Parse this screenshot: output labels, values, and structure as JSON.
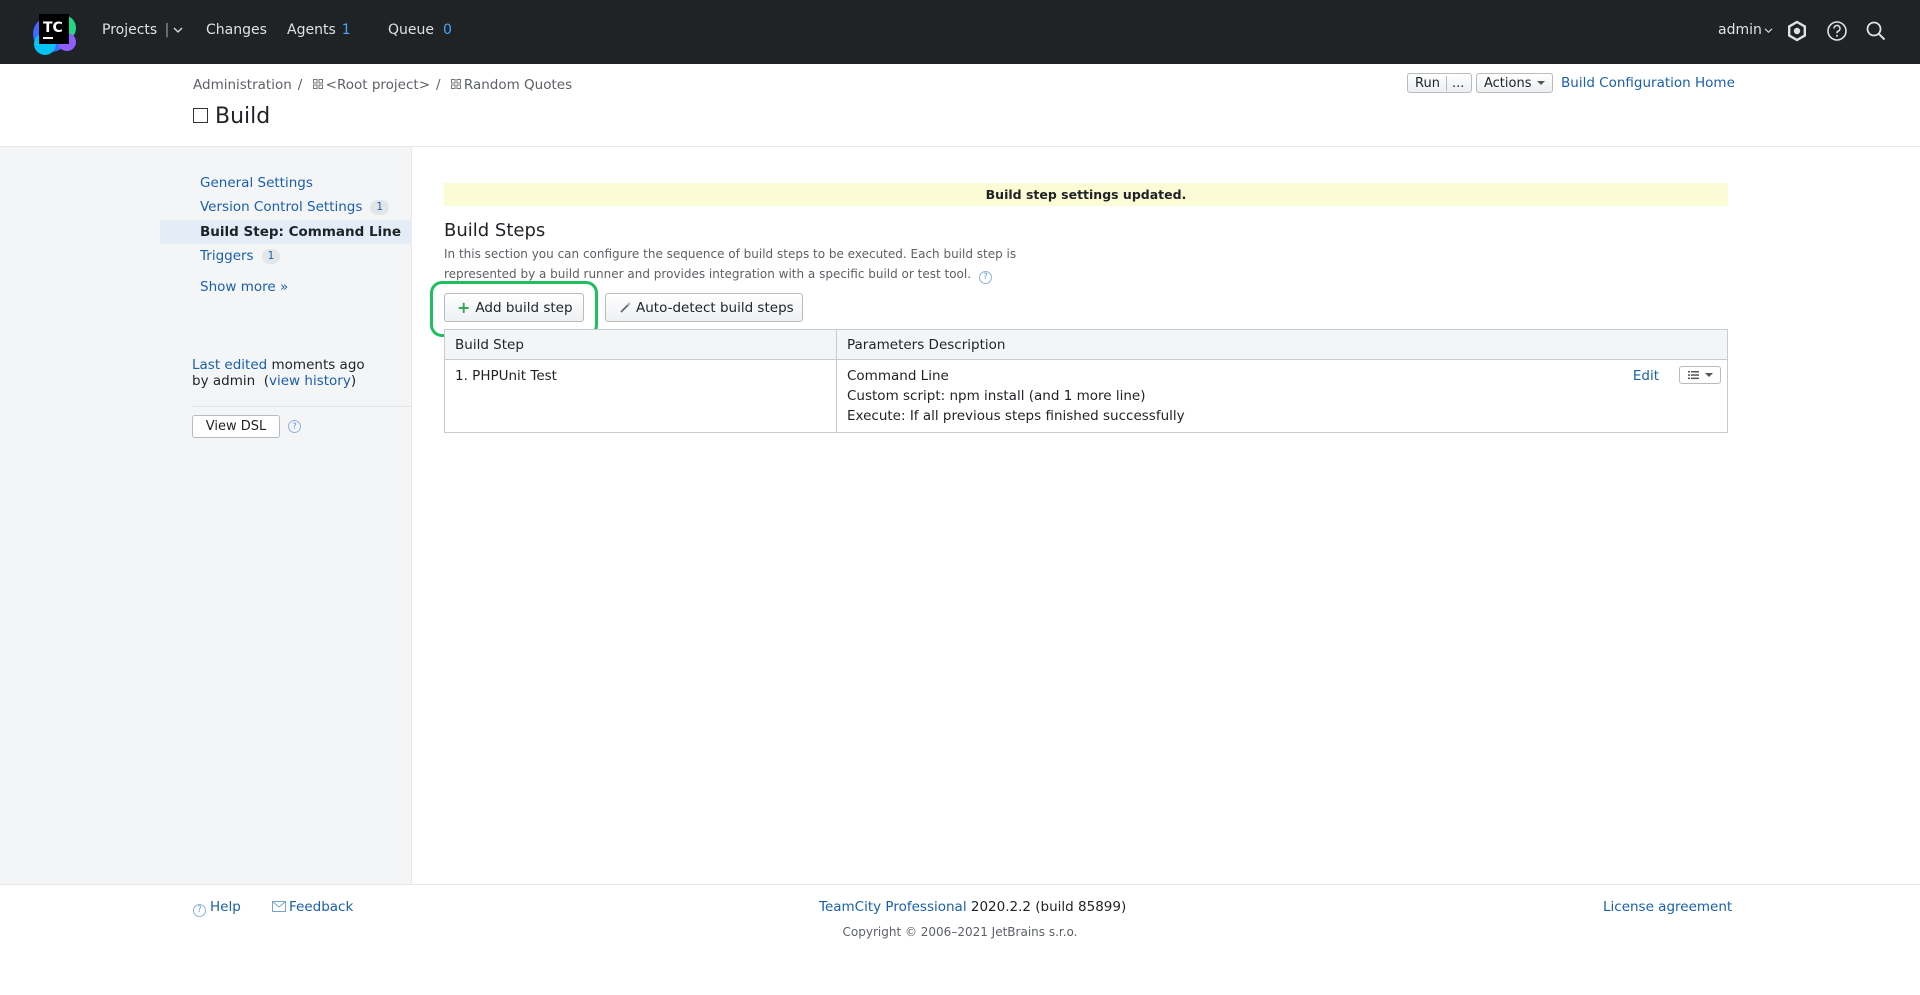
{
  "nav": {
    "logo_text": "TC",
    "projects": "Projects",
    "changes": "Changes",
    "agents": "Agents",
    "agents_count": "1",
    "queue": "Queue",
    "queue_count": "0",
    "user": "admin"
  },
  "header": {
    "breadcrumb": [
      "Administration",
      "<Root project>",
      "Random Quotes"
    ],
    "title": "Build",
    "run_label": "Run",
    "run_more_label": "...",
    "actions_label": "Actions",
    "home_link": "Build Configuration Home"
  },
  "sidebar": {
    "items": [
      {
        "label": "General Settings"
      },
      {
        "label": "Version Control Settings",
        "badge": "1"
      },
      {
        "label": "Build Step: Command Line"
      },
      {
        "label": "Triggers",
        "badge": "1"
      },
      {
        "label": "Show more »"
      }
    ],
    "last_edited": "Last edited",
    "last_edited_when": "moments ago",
    "by_admin": "by admin",
    "view_history": "view history",
    "view_dsl": "View DSL"
  },
  "main": {
    "notice": "Build step settings updated.",
    "section_title": "Build Steps",
    "section_desc": "In this section you can configure the sequence of build steps to be executed. Each build step is represented by a build runner and provides integration with a specific build or test tool.",
    "add_step": "Add build step",
    "auto_detect": "Auto-detect build steps",
    "table": {
      "headers": [
        "Build Step",
        "Parameters Description"
      ],
      "rows": [
        {
          "step": "1. PHPUnit Test",
          "params": [
            "Command Line",
            "Custom script: npm install (and 1 more line)",
            "Execute: If all previous steps finished successfully"
          ],
          "edit": "Edit"
        }
      ]
    }
  },
  "footer": {
    "help": "Help",
    "feedback": "Feedback",
    "product": "TeamCity Professional",
    "version": "2020.2.2 (build 85899)",
    "license": "License agreement",
    "copyright": "Copyright © 2006–2021 JetBrains s.r.o."
  },
  "colors": {
    "topbar": "#1f2326",
    "link": "#1a5faa",
    "highlight": "#1fbf5f",
    "notice_bg": "#fbfbd5"
  }
}
